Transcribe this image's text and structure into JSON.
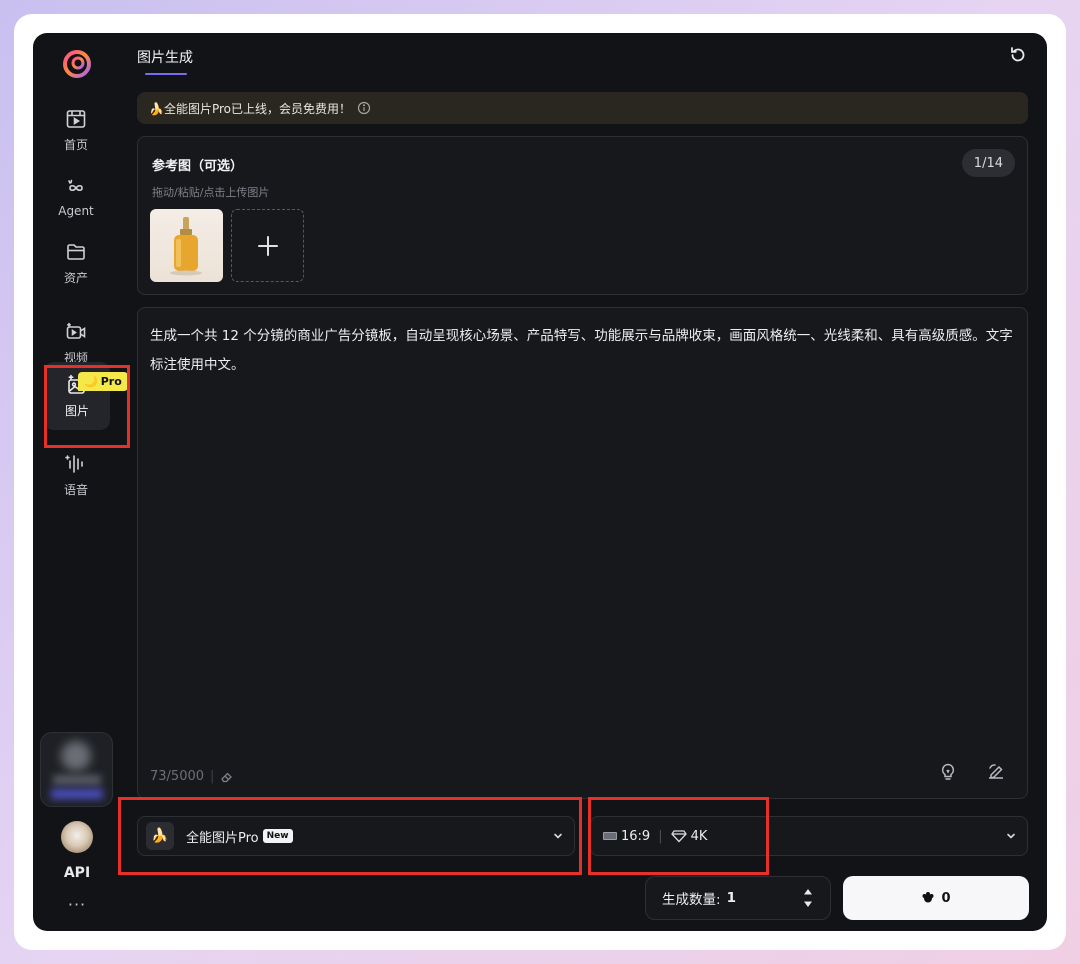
{
  "sidebar": {
    "items": [
      {
        "label": "首页",
        "icon": "home-icon"
      },
      {
        "label": "Agent",
        "icon": "agent-infinity-icon"
      },
      {
        "label": "资产",
        "icon": "folder-icon"
      },
      {
        "label": "视频",
        "icon": "video-icon"
      },
      {
        "label": "图片",
        "icon": "image-sparkle-icon",
        "active": true
      },
      {
        "label": "语音",
        "icon": "audio-wave-icon"
      }
    ],
    "pro_badge": "Pro",
    "api_label": "API",
    "more_label": "···"
  },
  "header": {
    "title": "图片生成"
  },
  "banner": {
    "text": "🍌全能图片Pro已上线，会员免费用！"
  },
  "reference": {
    "title": "参考图（可选）",
    "hint": "拖动/粘贴/点击上传图片",
    "count": "1/14"
  },
  "prompt": {
    "text": "生成一个共 12 个分镜的商业广告分镜板，自动呈现核心场景、产品特写、功能展示与品牌收束，画面风格统一、光线柔和、具有高级质感。文字标注使用中文。",
    "char_count": "73/5000"
  },
  "model": {
    "icon_glyph": "🍌",
    "name": "全能图片Pro",
    "tag": "New"
  },
  "params": {
    "ratio": "16:9",
    "resolution": "4K"
  },
  "quantity": {
    "label": "生成数量:",
    "value": "1"
  },
  "generate": {
    "cost": "0"
  },
  "colors": {
    "accent": "#7a6cf0",
    "highlight_box": "#e7302a",
    "pro_badge": "#f5e84a"
  }
}
